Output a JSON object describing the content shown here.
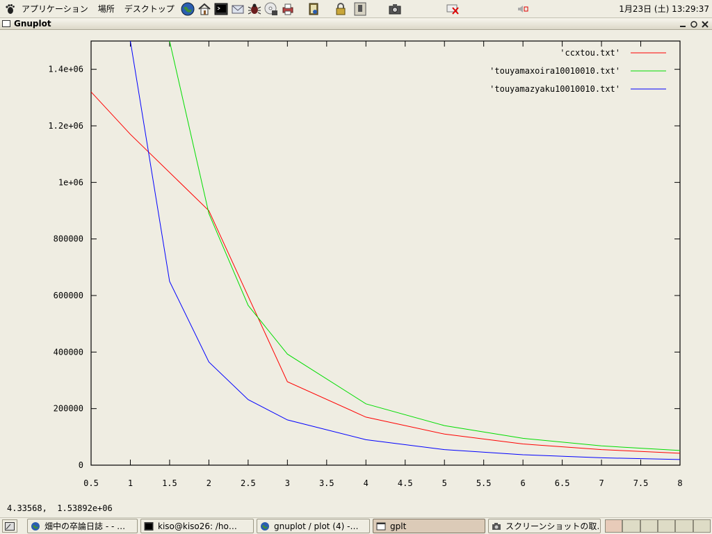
{
  "top_panel": {
    "menus": [
      "アプリケーション",
      "場所",
      "デスクトップ"
    ],
    "clock": "1月23日 (土) 13:29:37",
    "launchers": [
      "web-browser-icon",
      "home-folder-icon",
      "terminal-icon",
      "mail-icon",
      "bug-icon",
      "cd-writer-icon",
      "printer-icon",
      "notes-icon",
      "lock-icon"
    ],
    "tray": [
      "trash-applet-icon",
      "camera-applet-icon",
      "network-applet-icon",
      "volume-icon"
    ]
  },
  "window": {
    "title": "Gnuplot",
    "buttons": [
      "minimize",
      "maximize",
      "close"
    ]
  },
  "plot": {
    "mouse_coords": "4.33568,  1.53892e+06"
  },
  "chart_data": {
    "type": "line",
    "title": "",
    "xlabel": "",
    "ylabel": "",
    "xlim": [
      0.5,
      8
    ],
    "ylim": [
      0,
      1500000
    ],
    "xticks": [
      0.5,
      1,
      1.5,
      2,
      2.5,
      3,
      3.5,
      4,
      4.5,
      5,
      5.5,
      6,
      6.5,
      7,
      7.5,
      8
    ],
    "xtick_labels": [
      "0.5",
      "1",
      "1.5",
      "2",
      "2.5",
      "3",
      "3.5",
      "4",
      "4.5",
      "5",
      "5.5",
      "6",
      "6.5",
      "7",
      "7.5",
      "8"
    ],
    "yticks": [
      0,
      200000,
      400000,
      600000,
      800000,
      1000000,
      1200000,
      1400000
    ],
    "ytick_labels": [
      "0",
      "200000",
      "400000",
      "600000",
      "800000",
      "1e+06",
      "1.2e+06",
      "1.4e+06"
    ],
    "grid": false,
    "legend": "top-right",
    "series": [
      {
        "name": "'ccxtou.txt'",
        "color": "#ff0000",
        "x": [
          0.5,
          1,
          2,
          3,
          4,
          5,
          6,
          7,
          8
        ],
        "y": [
          1320000,
          1170000,
          900000,
          295000,
          170000,
          110000,
          75000,
          55000,
          42000
        ]
      },
      {
        "name": "'touyamaxoira10010010.txt'",
        "color": "#00dd00",
        "x": [
          1.5,
          2,
          2.5,
          3,
          4,
          5,
          6,
          7,
          8
        ],
        "y": [
          1500000,
          890000,
          565000,
          393000,
          217000,
          140000,
          95000,
          68000,
          52000
        ]
      },
      {
        "name": "'touyamazyaku10010010.txt'",
        "color": "#0000ff",
        "x": [
          1,
          1.5,
          2,
          2.5,
          3,
          4,
          5,
          6,
          7,
          8
        ],
        "y": [
          1500000,
          650000,
          365000,
          232000,
          160000,
          90000,
          55000,
          37000,
          26000,
          20000
        ]
      }
    ]
  },
  "taskbar": {
    "tasks": [
      {
        "label": "畑中の卒論日誌 - - …",
        "icon": "web-browser-icon"
      },
      {
        "label": "kiso@kiso26: /ho…",
        "icon": "terminal-icon"
      },
      {
        "label": "gnuplot / plot (4) -…",
        "icon": "web-browser-icon"
      },
      {
        "label": "gplt",
        "icon": "window-icon"
      },
      {
        "label": "スクリーンショットの取…",
        "icon": "camera-icon"
      }
    ]
  }
}
